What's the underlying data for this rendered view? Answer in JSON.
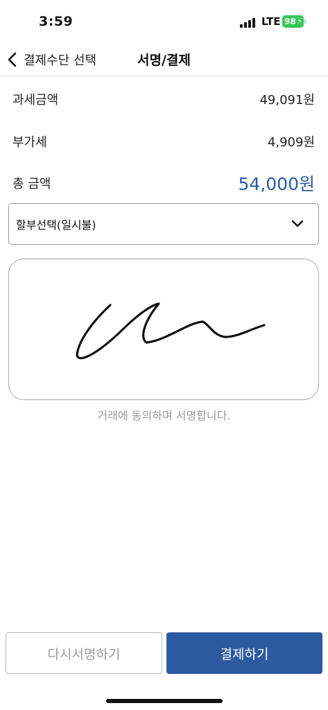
{
  "status_bar": {
    "time": "3:59",
    "network": "LTE",
    "battery": "98"
  },
  "nav": {
    "back_label": "결제수단 선택",
    "title": "서명/결제"
  },
  "summary": {
    "taxable_label": "과세금액",
    "taxable_value": "49,091원",
    "vat_label": "부가세",
    "vat_value": "4,909원",
    "total_label": "총 금액",
    "total_value": "54,000원"
  },
  "installment": {
    "selected": "할부선택(일시불)"
  },
  "signature": {
    "consent_text": "거래에 동의하며 서명합니다."
  },
  "buttons": {
    "resign_label": "다시서명하기",
    "pay_label": "결제하기"
  },
  "colors": {
    "accent": "#2c5aa0",
    "total_text": "#2a5ba0",
    "battery": "#34c759"
  }
}
